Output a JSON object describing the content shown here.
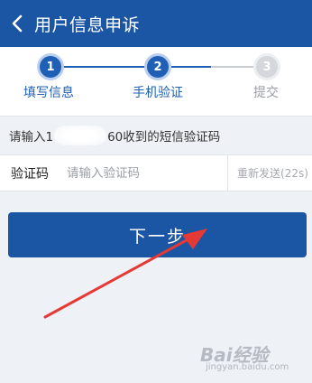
{
  "header": {
    "title": "用户信息申诉",
    "back_icon": "chevron-left-icon",
    "background": "#1b56a5"
  },
  "steps": [
    {
      "number": "1",
      "label": "填写信息",
      "state": "done"
    },
    {
      "number": "2",
      "label": "手机验证",
      "state": "current"
    },
    {
      "number": "3",
      "label": "提交",
      "state": "todo"
    }
  ],
  "verification": {
    "hint_prefix": "请输入1",
    "hint_suffix": "60收到的短信验证码",
    "code_label": "验证码",
    "code_placeholder": "请输入验证码",
    "code_value": "",
    "resend_label": "重新发送(22s)"
  },
  "actions": {
    "next_label": "下一步"
  },
  "watermark": {
    "brand": "Bai经验",
    "url": "jingyan.baidu.com"
  },
  "colors": {
    "primary": "#1b56a5",
    "step_active": "#1f5fb4",
    "step_inactive": "#d4d7dc",
    "annotation_arrow": "#e53935"
  }
}
